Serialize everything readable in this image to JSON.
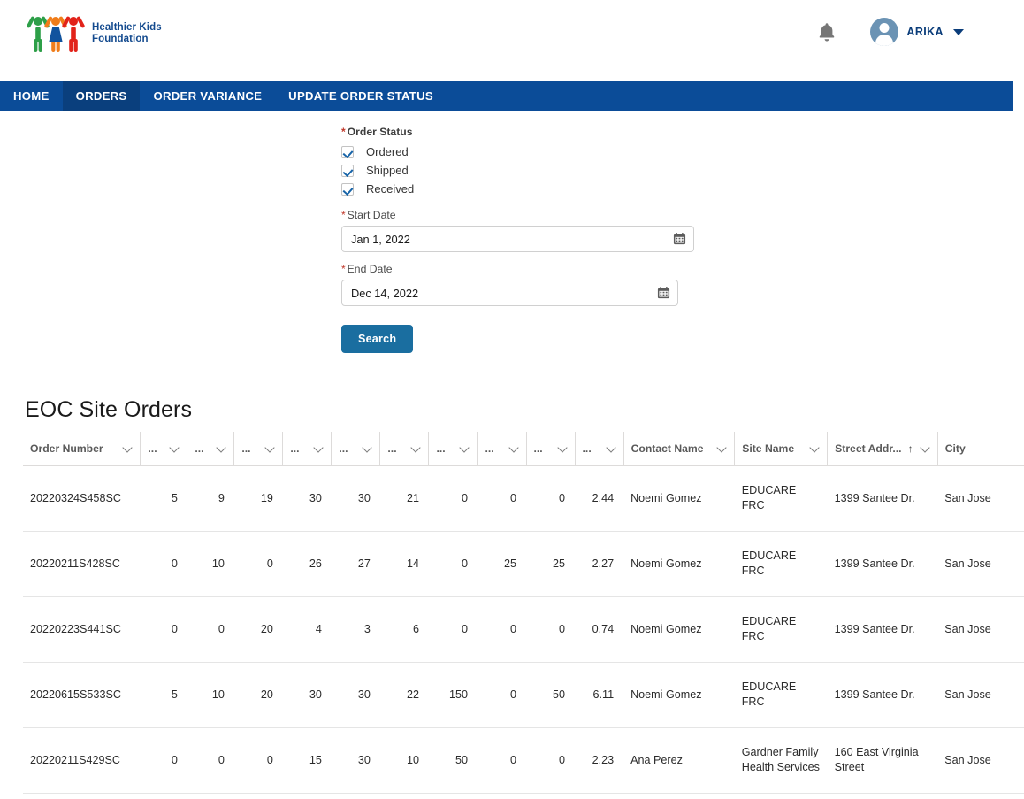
{
  "brand": {
    "line1": "Healthier Kids",
    "line2": "Foundation",
    "logo_icon": "three-children-logo",
    "colors": {
      "green": "#2d9f48",
      "blue": "#11539e",
      "orange": "#f07d1a",
      "red": "#e2231a",
      "text": "#134a8e"
    }
  },
  "header": {
    "notification_icon": "bell-icon",
    "avatar_icon": "user-avatar-icon",
    "username": "ARIKA",
    "caret_icon": "caret-down-icon"
  },
  "nav": {
    "active": "ORDERS",
    "bg": "#0b4c98",
    "active_bg": "#0a3f7d",
    "items": [
      {
        "label": "HOME"
      },
      {
        "label": "ORDERS"
      },
      {
        "label": "ORDER VARIANCE"
      },
      {
        "label": "UPDATE ORDER STATUS"
      }
    ]
  },
  "form": {
    "required_marker": "*",
    "order_status_label": "Order Status",
    "checkboxes": [
      {
        "label": "Ordered",
        "checked": true
      },
      {
        "label": "Shipped",
        "checked": true
      },
      {
        "label": "Received",
        "checked": true
      }
    ],
    "start_date": {
      "label": "Start Date",
      "value": "Jan 1, 2022",
      "icon": "calendar-icon"
    },
    "end_date": {
      "label": "End Date",
      "value": "Dec 14, 2022",
      "icon": "calendar-icon"
    },
    "search_button": "Search",
    "search_button_color": "#1a6ea0"
  },
  "table": {
    "title": "EOC Site Orders",
    "columns": [
      {
        "label": "Order Number",
        "sort_icon": "chevron-down-icon",
        "sorted": false
      },
      {
        "label": "...",
        "sort_icon": "chevron-down-icon",
        "sorted": false
      },
      {
        "label": "...",
        "sort_icon": "chevron-down-icon",
        "sorted": false
      },
      {
        "label": "...",
        "sort_icon": "chevron-down-icon",
        "sorted": false
      },
      {
        "label": "...",
        "sort_icon": "chevron-down-icon",
        "sorted": false
      },
      {
        "label": "...",
        "sort_icon": "chevron-down-icon",
        "sorted": false
      },
      {
        "label": "...",
        "sort_icon": "chevron-down-icon",
        "sorted": false
      },
      {
        "label": "...",
        "sort_icon": "chevron-down-icon",
        "sorted": false
      },
      {
        "label": "...",
        "sort_icon": "chevron-down-icon",
        "sorted": false
      },
      {
        "label": "...",
        "sort_icon": "chevron-down-icon",
        "sorted": false
      },
      {
        "label": "...",
        "sort_icon": "chevron-down-icon",
        "sorted": false
      },
      {
        "label": "Contact Name",
        "sort_icon": "chevron-down-icon",
        "sorted": false
      },
      {
        "label": "Site Name",
        "sort_icon": "chevron-down-icon",
        "sorted": false
      },
      {
        "label": "Street Addr...",
        "sort_icon": "chevron-down-icon",
        "sorted": true,
        "sort_dir": "↑"
      },
      {
        "label": "City",
        "sort_icon": "",
        "sorted": false
      }
    ],
    "rows": [
      {
        "order_number": "20220324S458SC",
        "n": [
          "5",
          "9",
          "19",
          "30",
          "30",
          "21",
          "0",
          "0",
          "0",
          "2.44"
        ],
        "contact_name": "Noemi Gomez",
        "site_name": "EDUCARE FRC",
        "street_address": "1399 Santee Dr.",
        "city": "San Jose"
      },
      {
        "order_number": "20220211S428SC",
        "n": [
          "0",
          "10",
          "0",
          "26",
          "27",
          "14",
          "0",
          "25",
          "25",
          "2.27"
        ],
        "contact_name": "Noemi Gomez",
        "site_name": "EDUCARE FRC",
        "street_address": "1399 Santee Dr.",
        "city": "San Jose"
      },
      {
        "order_number": "20220223S441SC",
        "n": [
          "0",
          "0",
          "20",
          "4",
          "3",
          "6",
          "0",
          "0",
          "0",
          "0.74"
        ],
        "contact_name": "Noemi Gomez",
        "site_name": "EDUCARE FRC",
        "street_address": "1399 Santee Dr.",
        "city": "San Jose"
      },
      {
        "order_number": "20220615S533SC",
        "n": [
          "5",
          "10",
          "20",
          "30",
          "30",
          "22",
          "150",
          "0",
          "50",
          "6.11"
        ],
        "contact_name": "Noemi Gomez",
        "site_name": "EDUCARE FRC",
        "street_address": "1399 Santee Dr.",
        "city": "San Jose"
      },
      {
        "order_number": "20220211S429SC",
        "n": [
          "0",
          "0",
          "0",
          "15",
          "30",
          "10",
          "50",
          "0",
          "0",
          "2.23"
        ],
        "contact_name": "Ana Perez",
        "site_name": "Gardner Family Health Services",
        "street_address": "160 East Virginia Street",
        "city": "San Jose"
      }
    ]
  }
}
